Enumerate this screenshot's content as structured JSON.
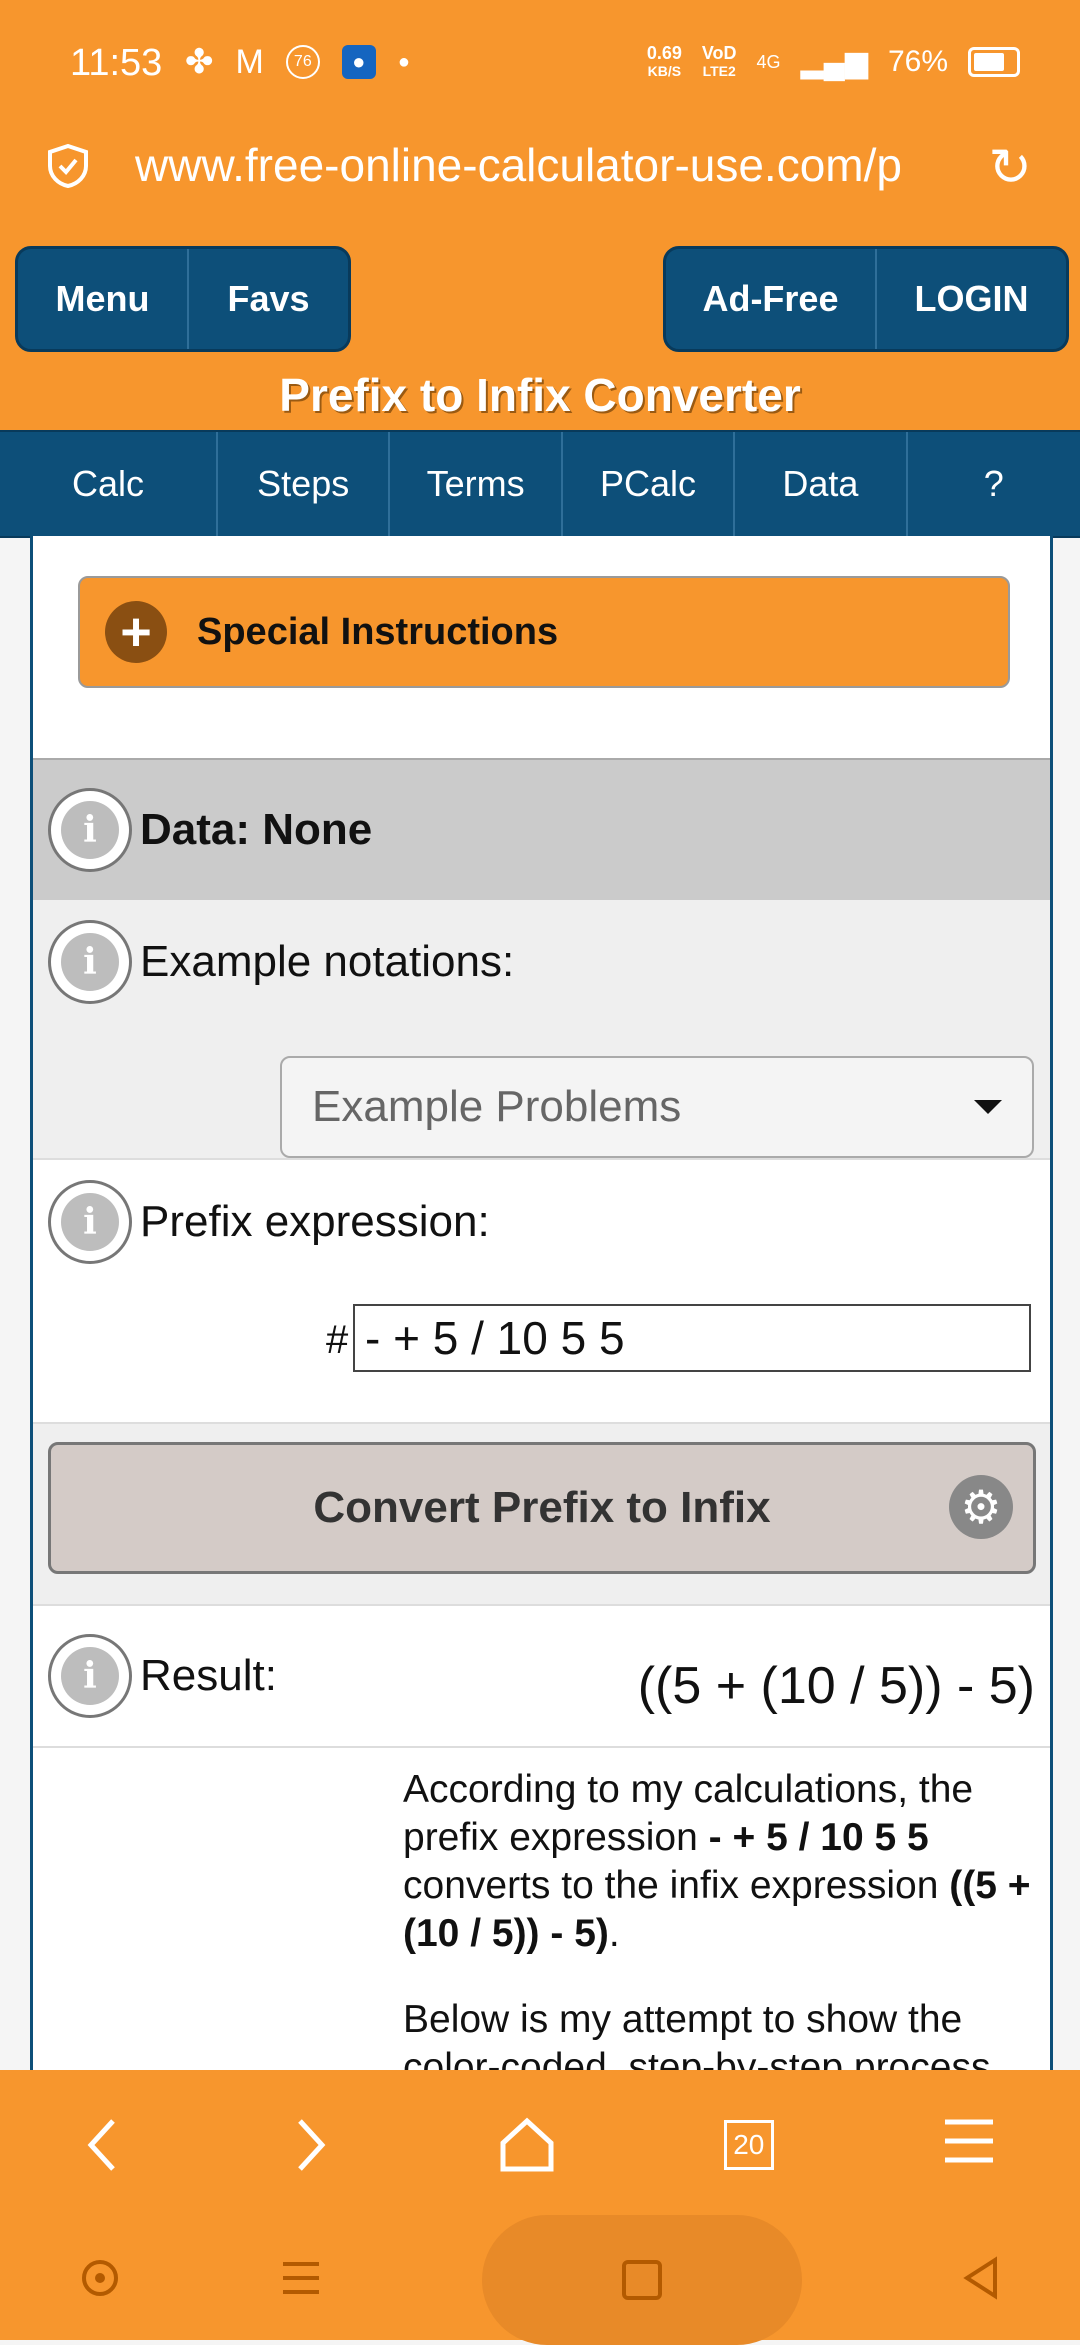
{
  "status_bar": {
    "time": "11:53",
    "net_speed_top": "0.69",
    "net_speed_bottom": "KB/S",
    "volte_top": "VoD",
    "volte_bottom": "LTE2",
    "network": "4G",
    "battery": "76%",
    "badge_count": "76"
  },
  "browser": {
    "url": "www.free-online-calculator-use.com/p",
    "tab_count": "20"
  },
  "header": {
    "left_buttons": [
      "Menu",
      "Favs"
    ],
    "right_buttons": [
      "Ad-Free",
      "LOGIN"
    ],
    "title": "Prefix to Infix Converter"
  },
  "tabs": [
    "Calc",
    "Steps",
    "Terms",
    "PCalc",
    "Data",
    "?"
  ],
  "calculator": {
    "special_instructions": "Special Instructions",
    "data_label": "Data: None",
    "examples_label": "Example notations:",
    "examples_select": "Example Problems",
    "prefix_label": "Prefix expression:",
    "prefix_hash": "#",
    "prefix_value": "- + 5 / 10 5 5",
    "convert_button": "Convert Prefix to Infix",
    "result_label": "Result:",
    "result_value": "((5 + (10 / 5)) - 5)"
  },
  "explanation": {
    "p1_a": "According to my calculations, the prefix expression ",
    "p1_b": "- + 5 / 10 5 5",
    "p1_c": " converts to the infix expression ",
    "p1_d": "((5 + (10 / 5)) - 5)",
    "p1_e": ".",
    "p2": "Below is my attempt to show the color-coded, step-by-step process"
  },
  "colors": {
    "orange": "#f7962d",
    "navy": "#0d4f79"
  }
}
